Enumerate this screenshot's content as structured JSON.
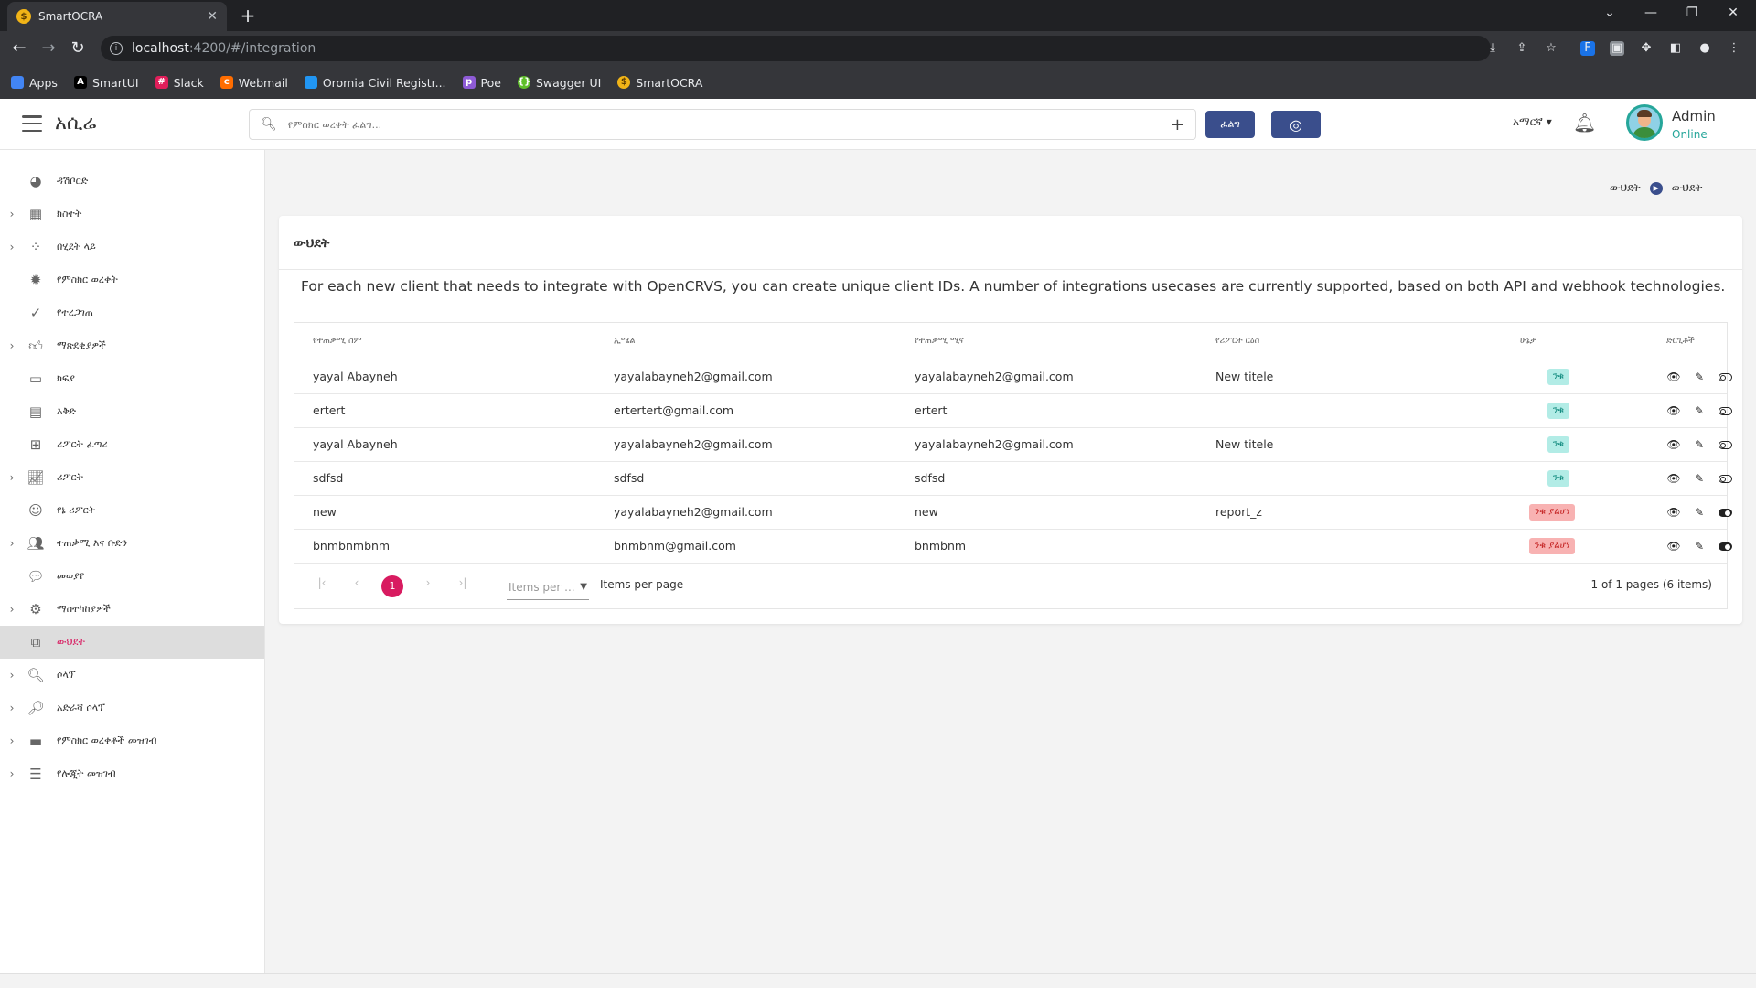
{
  "browser": {
    "tab_title": "SmartOCRA",
    "url_host": "localhost",
    "url_path": ":4200/#/integration",
    "bookmarks": [
      {
        "label": "Apps",
        "color": "#4285f4"
      },
      {
        "label": "SmartUI",
        "color": "#000000"
      },
      {
        "label": "Slack",
        "color": "#e01e5a"
      },
      {
        "label": "Webmail",
        "color": "#ff6d00"
      },
      {
        "label": "Oromia Civil Registr...",
        "color": "#2196f3"
      },
      {
        "label": "Poe",
        "color": "#8e5bd6"
      },
      {
        "label": "Swagger UI",
        "color": "#85ea2d"
      },
      {
        "label": "SmartOCRA",
        "color": "#f1b417"
      }
    ]
  },
  "header": {
    "brand": "አሲሬ",
    "search_placeholder": "የምስክር ወረቀት ፈልግ...",
    "search_button": "ፈልግ",
    "language": "አማርኛ",
    "user_name": "Admin",
    "user_status": "Online"
  },
  "sidebar": {
    "items": [
      {
        "label": "ዳሽቦርድ",
        "icon": "dashboard-icon",
        "expandable": false
      },
      {
        "label": "ክስተት",
        "icon": "calendar-icon",
        "expandable": true
      },
      {
        "label": "በሂደት ላይ",
        "icon": "spinner-icon",
        "expandable": true
      },
      {
        "label": "የምስክር ወረቀት",
        "icon": "certificate-icon",
        "expandable": false
      },
      {
        "label": "የተረጋገጠ",
        "icon": "check-circle-icon",
        "expandable": false
      },
      {
        "label": "ማጽደቂያዎች",
        "icon": "thumbs-up-icon",
        "expandable": true
      },
      {
        "label": "ክፍያ",
        "icon": "credit-card-icon",
        "expandable": false
      },
      {
        "label": "እቅድ",
        "icon": "calendar-plan-icon",
        "expandable": false
      },
      {
        "label": "ሪፖርት ፈጣሪ",
        "icon": "plus-square-icon",
        "expandable": false
      },
      {
        "label": "ሪፖርት",
        "icon": "chart-line-icon",
        "expandable": true
      },
      {
        "label": "የኔ ሪፖርት",
        "icon": "smiley-icon",
        "expandable": false
      },
      {
        "label": "ተጠቃሚ እና ቡድን",
        "icon": "users-icon",
        "expandable": true
      },
      {
        "label": "መወያየ",
        "icon": "chat-icon",
        "expandable": false
      },
      {
        "label": "ማስተካከያዎች",
        "icon": "gear-icon",
        "expandable": true
      },
      {
        "label": "ውህደት",
        "icon": "external-link-icon",
        "expandable": false,
        "active": true
      },
      {
        "label": "ሶላፕ",
        "icon": "zoom-icon",
        "expandable": true
      },
      {
        "label": "አድራሻ ሶላፕ",
        "icon": "zoom-plus-icon",
        "expandable": true
      },
      {
        "label": "የምስክር ወረቀቶች መዝገብ",
        "icon": "archive-icon",
        "expandable": true
      },
      {
        "label": "የሎጂት መዝገብ",
        "icon": "list-icon",
        "expandable": true
      }
    ]
  },
  "breadcrumb": {
    "parent": "ውህደት",
    "current": "ውህደት"
  },
  "page": {
    "title": "ውህደት",
    "description": "For each new client that needs to integrate with OpenCRVS, you can create unique client IDs. A number of integrations usecases are currently supported, based on both API and webhook technologies."
  },
  "table": {
    "headers": {
      "name": "የተጠቃሚ ስም",
      "email": "ኢሜል",
      "username": "የተጠቃሚ ሚና",
      "report": "የሪፖርት ርዕስ",
      "status": "ሁኔታ",
      "actions": "ድርጊቶች"
    },
    "rows": [
      {
        "name": "yayal Abayneh",
        "email": "yayalabayneh2@gmail.com",
        "username": "yayalabayneh2@gmail.com",
        "report": "New titele",
        "status": "ንቁ",
        "active": true
      },
      {
        "name": "ertert",
        "email": "ertertert@gmail.com",
        "username": "ertert",
        "report": "",
        "status": "ንቁ",
        "active": true
      },
      {
        "name": "yayal Abayneh",
        "email": "yayalabayneh2@gmail.com",
        "username": "yayalabayneh2@gmail.com",
        "report": "New titele",
        "status": "ንቁ",
        "active": true
      },
      {
        "name": "sdfsd",
        "email": "sdfsd",
        "username": "sdfsd",
        "report": "",
        "status": "ንቁ",
        "active": true
      },
      {
        "name": "new",
        "email": "yayalabayneh2@gmail.com",
        "username": "new",
        "report": "report_z",
        "status": "ንቁ ያልሆነ",
        "active": false
      },
      {
        "name": "bnmbnmbnm",
        "email": "bnmbnm@gmail.com",
        "username": "bnmbnm",
        "report": "",
        "status": "ንቁ ያልሆነ",
        "active": false
      }
    ]
  },
  "paginator": {
    "current_page": "1",
    "items_per_page_placeholder": "Items per ...",
    "items_per_page_label": "Items per page",
    "summary": "1 of 1 pages (6 items)"
  }
}
